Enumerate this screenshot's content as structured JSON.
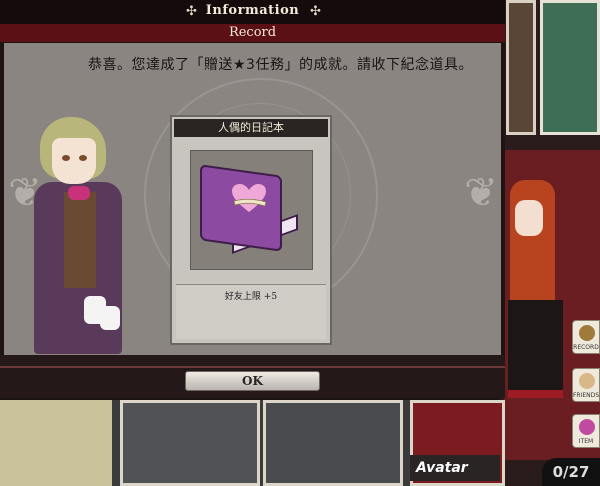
{
  "dialog": {
    "title": "Information",
    "subtitle": "Record",
    "message": "恭喜。您達成了「贈送★3任務」的成就。請收下紀念道具。",
    "ok_label": "OK"
  },
  "reward": {
    "name": "人偶的日記本",
    "effect": "好友上限 +5",
    "icon": "purple-diary-book-icon"
  },
  "background": {
    "avatar_label": "Avatar",
    "counter": "0/27",
    "side_buttons": [
      "RECORD",
      "FRIENDS",
      "ITEM"
    ]
  },
  "colors": {
    "title_bar": "#140c0c",
    "subtitle_bar": "#5a1014",
    "panel": "#8a8581",
    "book": "#8c4aa0"
  }
}
